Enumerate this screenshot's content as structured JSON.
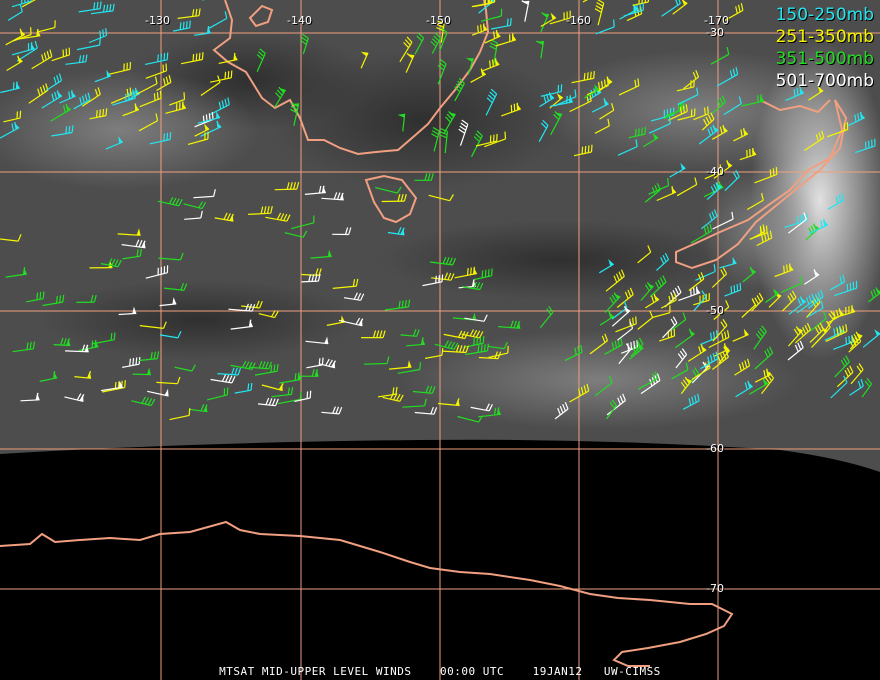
{
  "legend": [
    {
      "label": "150-250mb",
      "color": "#22e6f0"
    },
    {
      "label": "251-350mb",
      "color": "#f5f500"
    },
    {
      "label": "351-500mb",
      "color": "#22dd22"
    },
    {
      "label": "501-700mb",
      "color": "#ffffff"
    }
  ],
  "longitude_labels": [
    "-130",
    "-140",
    "-150",
    "-160",
    "-170"
  ],
  "latitude_labels": [
    "-30",
    "-40",
    "-50",
    "-60",
    "-70"
  ],
  "footer": {
    "product": "MTSAT MID-UPPER LEVEL WINDS",
    "time": "00:00 UTC",
    "date": "19JAN12",
    "source": "UW-CIMSS"
  },
  "colors": {
    "grid": "#f0a080",
    "coastline": "#f0a080",
    "satellite_background": "#4a4a4a",
    "space": "#000000"
  },
  "symbols": {
    "wind": "wind-barb-icon"
  }
}
